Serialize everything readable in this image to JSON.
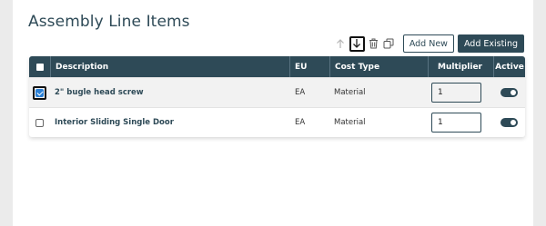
{
  "page": {
    "title": "Assembly Line Items"
  },
  "toolbar": {
    "move_up_icon": "arrow-up-icon",
    "move_down_icon": "arrow-down-icon",
    "delete_icon": "trash-icon",
    "copy_icon": "copy-icon",
    "add_new_label": "Add New",
    "add_existing_label": "Add Existing"
  },
  "table": {
    "columns": {
      "description": "Description",
      "eu": "EU",
      "cost_type": "Cost Type",
      "multiplier": "Multiplier",
      "active": "Active"
    },
    "rows": [
      {
        "selected": true,
        "description": "2\" bugle head screw",
        "eu": "EA",
        "cost_type": "Material",
        "multiplier": "1",
        "active": true
      },
      {
        "selected": false,
        "description": "Interior Sliding Single Door",
        "eu": "EA",
        "cost_type": "Material",
        "multiplier": "1",
        "active": true
      }
    ]
  },
  "colors": {
    "header_bg": "#2e4a57",
    "accent": "#2a7fd4",
    "page_bg": "#ebebeb"
  }
}
